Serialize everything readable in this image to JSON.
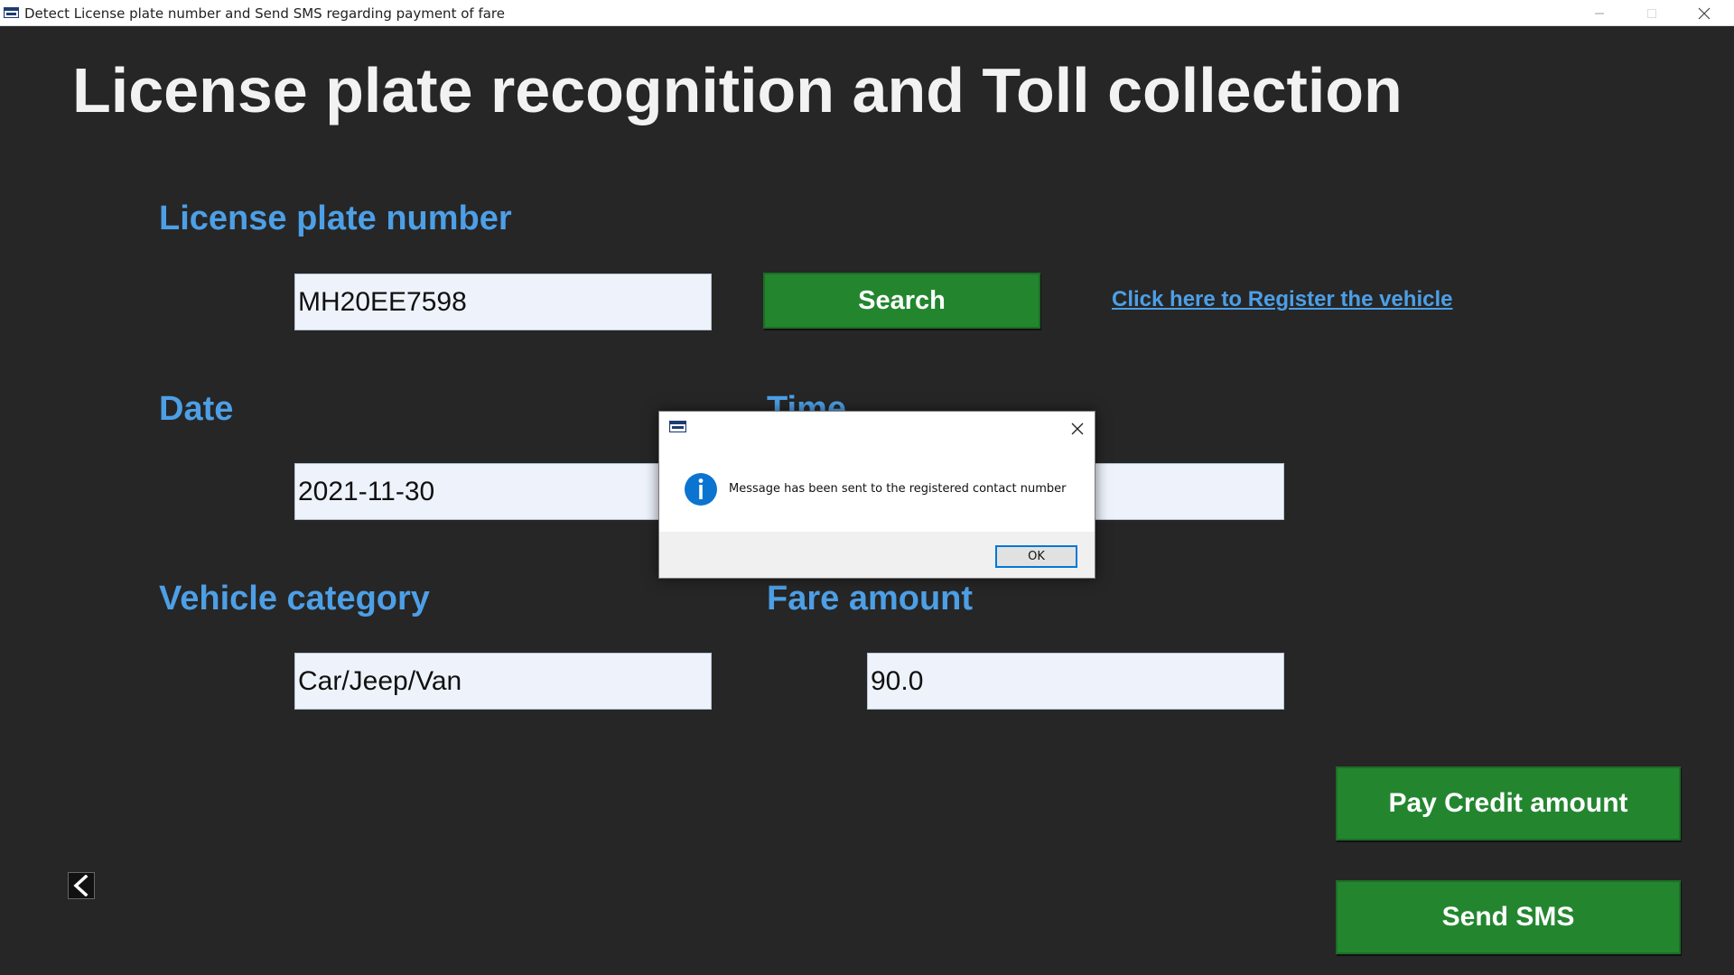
{
  "window": {
    "title": "Detect License plate number and Send SMS regarding payment of fare"
  },
  "main": {
    "title": "License plate recognition and Toll collection",
    "plate_label": "License plate number",
    "plate_value": "MH20EE7598",
    "search_label": "Search",
    "register_link": "Click here to Register the vehicle",
    "date_label": "Date",
    "date_value": "2021-11-30",
    "time_label": "Time",
    "time_value": "",
    "category_label": "Vehicle category",
    "category_value": "Car/Jeep/Van",
    "fare_label": "Fare amount",
    "fare_value": "90.0",
    "pay_credit_label": "Pay Credit amount",
    "send_sms_label": "Send SMS"
  },
  "dialog": {
    "message": "Message has been sent to the registered contact number",
    "ok_label": "OK"
  },
  "colors": {
    "background": "#262626",
    "accent_text": "#4d9fe6",
    "button_green": "#23862f",
    "field_bg": "#eef3fb",
    "info_blue": "#0b74d1"
  },
  "icons": {
    "app": "app-window-icon",
    "back": "chevron-left-icon",
    "info": "info-icon",
    "close": "close-icon"
  }
}
